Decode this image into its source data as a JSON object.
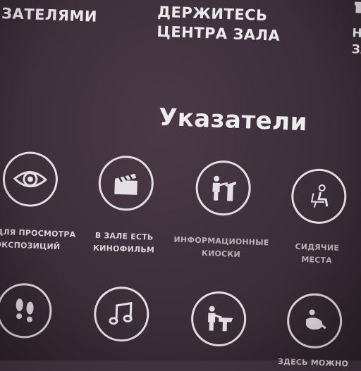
{
  "top": {
    "left_text": "ТЕ\nЗАТЕЛЯМИ",
    "center_text": "ДЕРЖИТЕСЬ\nЦЕНТРА ЗАЛА",
    "right_text": "НЕ\nЗА"
  },
  "heading": "Указатели",
  "row1": [
    {
      "icon": "eye-icon",
      "caption": "ТО ДЛЯ ПРОСМОТРА\nЭКСПОЗИЦИЙ"
    },
    {
      "icon": "clapperboard-icon",
      "caption": "В ЗАЛЕ ЕСТЬ\nКИНОФИЛЬМ"
    },
    {
      "icon": "info-kiosk-icon",
      "caption": "ИНФОРМАЦИОННЫЕ\nКИОСКИ"
    },
    {
      "icon": "seat-icon",
      "caption": "СИДЯЧИЕ\nМЕСТА"
    }
  ],
  "row2": [
    {
      "icon": "footprints-icon",
      "caption": ""
    },
    {
      "icon": "music-note-icon",
      "caption": ""
    },
    {
      "icon": "info-desk-icon",
      "caption": ""
    },
    {
      "icon": "lounging-person-icon",
      "caption": "ЗДЕСЬ МОЖНО"
    }
  ]
}
